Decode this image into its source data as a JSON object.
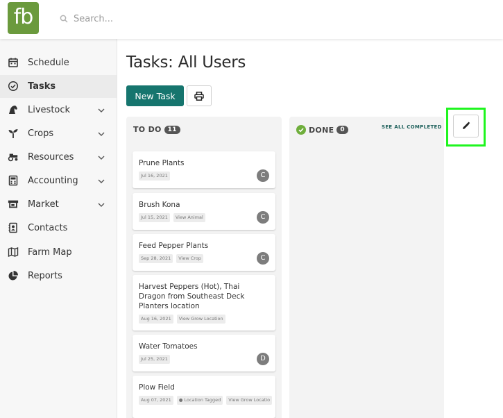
{
  "brand": {
    "logo_text": "fb",
    "color": "#6b9a3d"
  },
  "search": {
    "placeholder": "Search..."
  },
  "sidebar": {
    "items": [
      {
        "label": "Schedule",
        "icon": "calendar-icon",
        "expandable": false,
        "active": false
      },
      {
        "label": "Tasks",
        "icon": "check-circle-icon",
        "expandable": false,
        "active": true
      },
      {
        "label": "Livestock",
        "icon": "horse-icon",
        "expandable": true,
        "active": false
      },
      {
        "label": "Crops",
        "icon": "seedling-icon",
        "expandable": true,
        "active": false
      },
      {
        "label": "Resources",
        "icon": "tractor-icon",
        "expandable": true,
        "active": false
      },
      {
        "label": "Accounting",
        "icon": "calculator-icon",
        "expandable": true,
        "active": false
      },
      {
        "label": "Market",
        "icon": "store-icon",
        "expandable": true,
        "active": false
      },
      {
        "label": "Contacts",
        "icon": "address-book-icon",
        "expandable": false,
        "active": false
      },
      {
        "label": "Farm Map",
        "icon": "map-icon",
        "expandable": false,
        "active": false
      },
      {
        "label": "Reports",
        "icon": "pie-chart-icon",
        "expandable": false,
        "active": false
      }
    ]
  },
  "page": {
    "title": "Tasks: All Users",
    "new_task_label": "New Task",
    "print_icon": "print-icon",
    "edit_icon": "pencil-icon"
  },
  "columns": {
    "todo": {
      "label": "TO DO",
      "count": "11",
      "cards": [
        {
          "title": "Prune Plants",
          "tags": [
            "Jul 16, 2021"
          ],
          "avatar": "C"
        },
        {
          "title": "Brush Kona",
          "tags": [
            "Jul 15, 2021",
            "View Animal"
          ],
          "avatar": "C"
        },
        {
          "title": "Feed Pepper Plants",
          "tags": [
            "Sep 28, 2021",
            "View Crop"
          ],
          "avatar": "C"
        },
        {
          "title": "Harvest Peppers (Hot), Thai Dragon from Southeast Deck Planters location",
          "tags": [
            "Aug 16, 2021",
            "View Grow Location"
          ],
          "avatar": ""
        },
        {
          "title": "Water Tomatoes",
          "tags": [
            "Jul 25, 2021"
          ],
          "avatar": "D"
        },
        {
          "title": "Plow Field",
          "tags": [
            "Aug 07, 2021",
            "Location Tagged",
            "View Grow Locatio"
          ],
          "avatar": ""
        }
      ]
    },
    "done": {
      "label": "DONE",
      "count": "0",
      "see_all_label": "SEE ALL COMPLETED"
    }
  },
  "colors": {
    "primary": "#16756e",
    "done_green": "#6fae3c",
    "highlight": "#1ff51f"
  }
}
